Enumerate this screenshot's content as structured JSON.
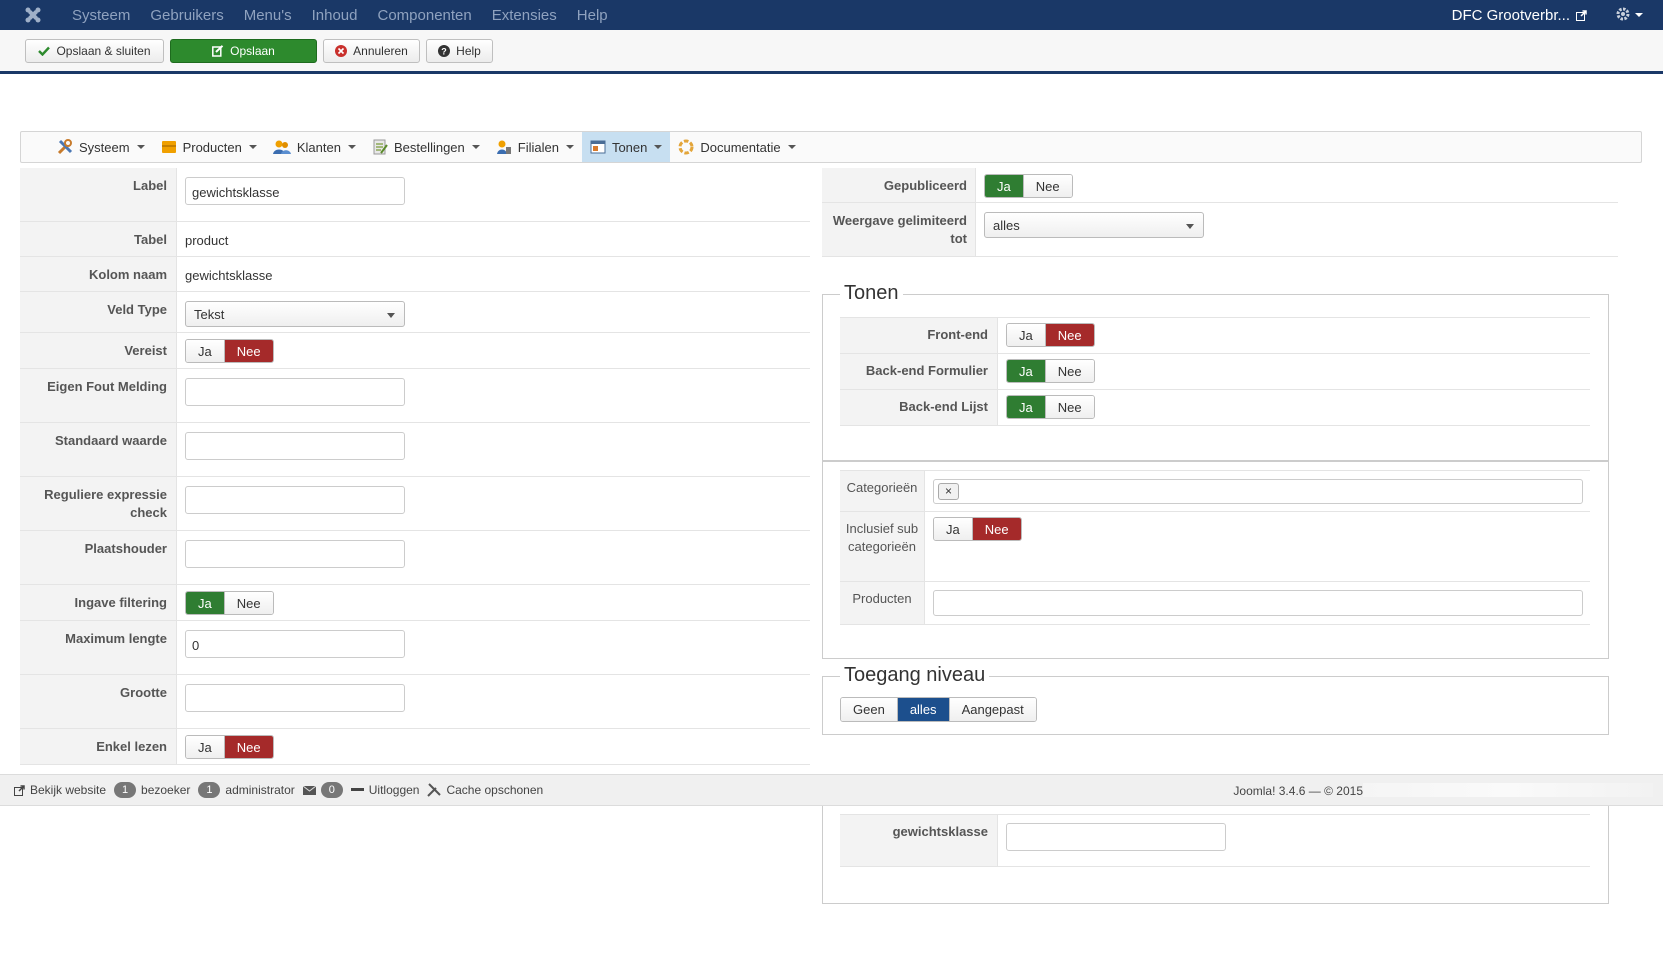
{
  "topbar": {
    "menu": [
      "Systeem",
      "Gebruikers",
      "Menu's",
      "Inhoud",
      "Componenten",
      "Extensies",
      "Help"
    ],
    "site_name": "DFC Grootverbr..."
  },
  "toolbar": {
    "save_close": "Opslaan & sluiten",
    "save": "Opslaan",
    "cancel": "Annuleren",
    "help": "Help"
  },
  "submenu": [
    "Systeem",
    "Producten",
    "Klanten",
    "Bestellingen",
    "Filialen",
    "Tonen",
    "Documentatie"
  ],
  "form": {
    "label": {
      "label": "Label",
      "value": "gewichtsklasse"
    },
    "tabel": {
      "label": "Tabel",
      "value": "product"
    },
    "kolom": {
      "label": "Kolom naam",
      "value": "gewichtsklasse"
    },
    "veldtype": {
      "label": "Veld Type",
      "value": "Tekst"
    },
    "vereist": {
      "label": "Vereist",
      "ja": "Ja",
      "nee": "Nee"
    },
    "fout": {
      "label": "Eigen Fout Melding",
      "value": ""
    },
    "standaard": {
      "label": "Standaard waarde",
      "value": ""
    },
    "regex": {
      "label": "Reguliere expressie check",
      "value": ""
    },
    "placeholder": {
      "label": "Plaatshouder",
      "value": ""
    },
    "filtering": {
      "label": "Ingave filtering",
      "ja": "Ja",
      "nee": "Nee"
    },
    "maxlen": {
      "label": "Maximum lengte",
      "value": "0"
    },
    "grootte": {
      "label": "Grootte",
      "value": ""
    },
    "readonly": {
      "label": "Enkel lezen",
      "ja": "Ja",
      "nee": "Nee"
    }
  },
  "right": {
    "published": {
      "label": "Gepubliceerd",
      "ja": "Ja",
      "nee": "Nee"
    },
    "limited": {
      "label": "Weergave gelimiteerd tot",
      "value": "alles"
    },
    "tonen": {
      "legend": "Tonen",
      "frontend": "Front-end",
      "backend_form": "Back-end Formulier",
      "backend_list": "Back-end Lijst",
      "ja": "Ja",
      "nee": "Nee"
    },
    "categories": {
      "label": "Categorieën",
      "inclusive_label": "Inclusief sub categorieën",
      "products_label": "Producten",
      "ja": "Ja",
      "nee": "Nee",
      "clear": "×"
    },
    "access": {
      "legend": "Toegang niveau",
      "options": [
        "Geen",
        "alles",
        "Aangepast"
      ]
    },
    "extra": {
      "label": "gewichtsklasse",
      "value": ""
    }
  },
  "status": {
    "view_site": "Bekijk website",
    "visitors_count": "1",
    "visitors": "bezoeker",
    "admins_count": "1",
    "admins": "administrator",
    "messages_count": "0",
    "logout": "Uitloggen",
    "cache": "Cache opschonen",
    "version": "Joomla! 3.4.6 — © 2015"
  },
  "colors": {
    "navy": "#1a3867",
    "green": "#2f7d32",
    "red": "#a52a2a",
    "blue": "#1c4f8d"
  }
}
